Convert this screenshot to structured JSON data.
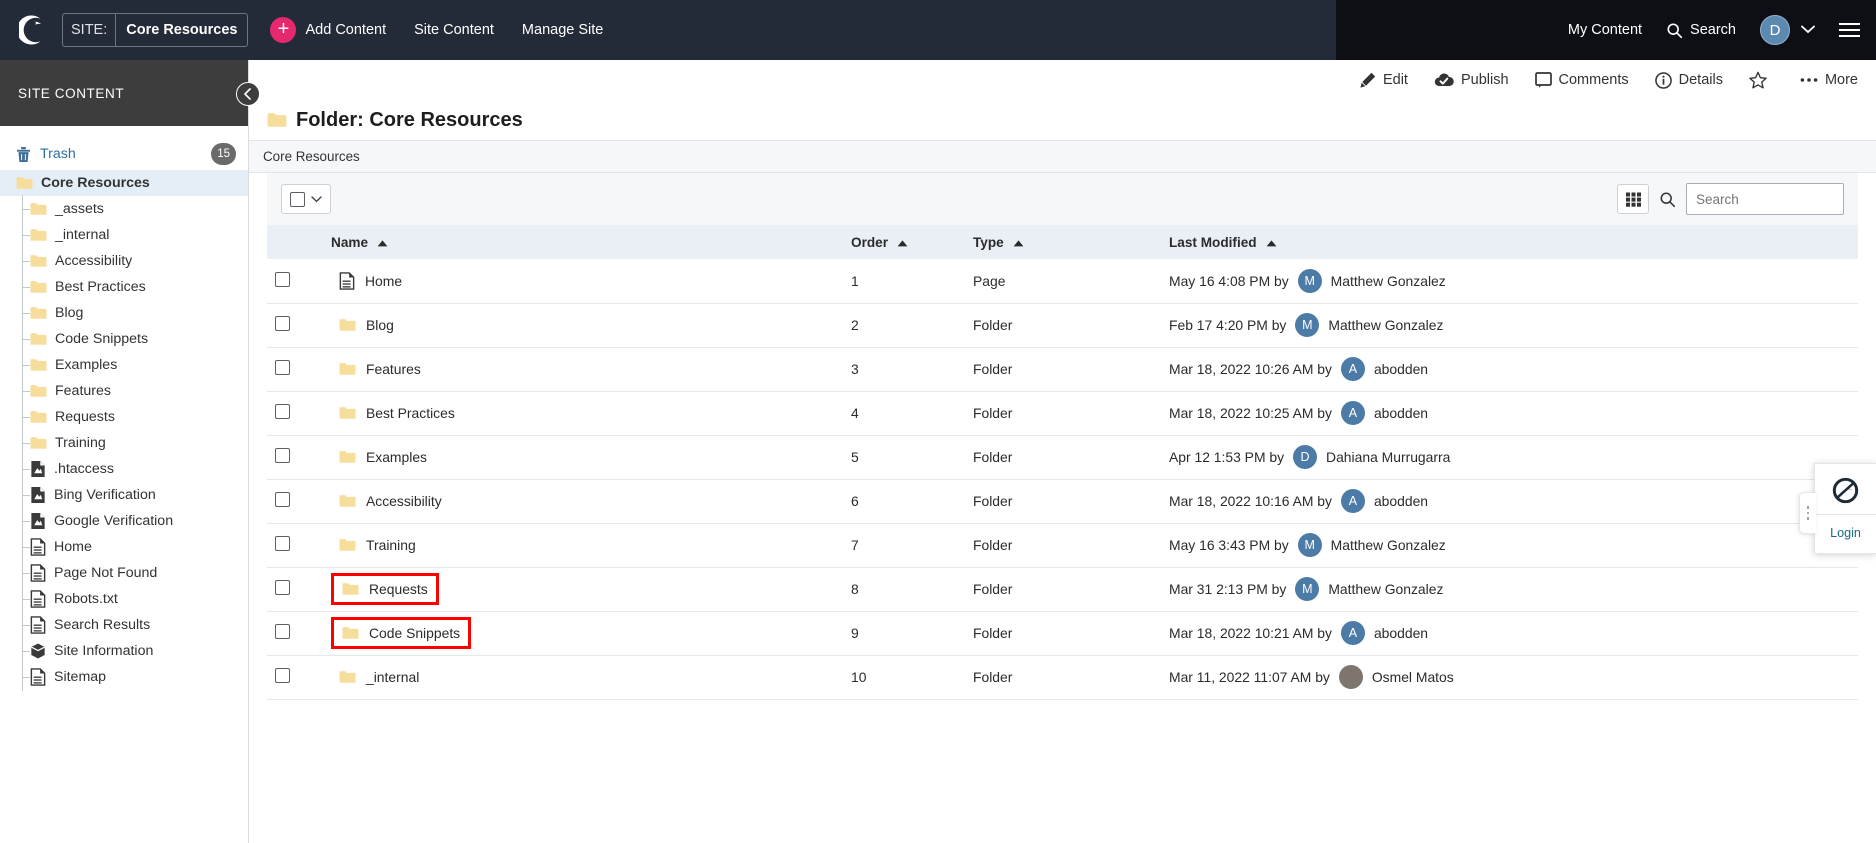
{
  "topbar": {
    "logo_icon": "cascade-moon-logo",
    "site_label": "SITE:",
    "site_value": "Core Resources",
    "add_content": "Add Content",
    "nav": [
      "Site Content",
      "Manage Site"
    ],
    "my_content": "My Content",
    "search": "Search",
    "avatar_initial": "D",
    "accent_color": "#e6286e",
    "bar_color": "#242b38"
  },
  "sidebar": {
    "header": "SITE CONTENT",
    "collapse_icon": "chevron-left-icon",
    "trash": {
      "label": "Trash",
      "count": "15",
      "icon": "trash-icon"
    },
    "tree": [
      {
        "label": "Core Resources",
        "icon": "folder-icon",
        "level": 0,
        "selected": true
      },
      {
        "label": "_assets",
        "icon": "folder-icon",
        "level": 1
      },
      {
        "label": "_internal",
        "icon": "folder-icon",
        "level": 1
      },
      {
        "label": "Accessibility",
        "icon": "folder-icon",
        "level": 1
      },
      {
        "label": "Best Practices",
        "icon": "folder-icon",
        "level": 1
      },
      {
        "label": "Blog",
        "icon": "folder-icon",
        "level": 1
      },
      {
        "label": "Code Snippets",
        "icon": "folder-icon",
        "level": 1
      },
      {
        "label": "Examples",
        "icon": "folder-icon",
        "level": 1
      },
      {
        "label": "Features",
        "icon": "folder-icon",
        "level": 1
      },
      {
        "label": "Requests",
        "icon": "folder-icon",
        "level": 1
      },
      {
        "label": "Training",
        "icon": "folder-icon",
        "level": 1
      },
      {
        "label": ".htaccess",
        "icon": "file-icon",
        "level": 1
      },
      {
        "label": "Bing Verification",
        "icon": "file-icon",
        "level": 1
      },
      {
        "label": "Google Verification",
        "icon": "file-icon",
        "level": 1
      },
      {
        "label": "Home",
        "icon": "page-icon",
        "level": 1
      },
      {
        "label": "Page Not Found",
        "icon": "page-icon",
        "level": 1
      },
      {
        "label": "Robots.txt",
        "icon": "page-icon",
        "level": 1
      },
      {
        "label": "Search Results",
        "icon": "page-icon",
        "level": 1
      },
      {
        "label": "Site Information",
        "icon": "block-icon",
        "level": 1
      },
      {
        "label": "Sitemap",
        "icon": "page-icon",
        "level": 1
      }
    ]
  },
  "actionbar": [
    {
      "label": "Edit",
      "icon": "pencil-icon"
    },
    {
      "label": "Publish",
      "icon": "cloud-check-icon"
    },
    {
      "label": "Comments",
      "icon": "comment-icon"
    },
    {
      "label": "Details",
      "icon": "info-circle-icon"
    },
    {
      "label": "",
      "icon": "star-icon"
    },
    {
      "label": "More",
      "icon": "ellipsis-icon"
    }
  ],
  "page": {
    "title": "Folder: Core Resources",
    "title_icon": "folder-icon",
    "breadcrumb": "Core Resources"
  },
  "table_toolbar": {
    "select_all_icon": "checkbox-icon",
    "select_dropdown_icon": "chevron-down-icon",
    "grid_view_icon": "grid-icon",
    "search_icon": "search-icon",
    "search_placeholder": "Search",
    "search_value": ""
  },
  "table": {
    "columns": [
      {
        "label": "Name",
        "sort": "asc"
      },
      {
        "label": "Order",
        "sort": "asc"
      },
      {
        "label": "Type",
        "sort": "asc"
      },
      {
        "label": "Last Modified",
        "sort": "asc"
      }
    ],
    "rows": [
      {
        "name": "Home",
        "icon": "page-icon",
        "order": "1",
        "type": "Page",
        "date": "May 16 4:08 PM by",
        "user": "Matthew Gonzalez",
        "initial": "M",
        "highlight": false
      },
      {
        "name": "Blog",
        "icon": "folder-icon",
        "order": "2",
        "type": "Folder",
        "date": "Feb 17 4:20 PM by",
        "user": "Matthew Gonzalez",
        "initial": "M",
        "highlight": false
      },
      {
        "name": "Features",
        "icon": "folder-icon",
        "order": "3",
        "type": "Folder",
        "date": "Mar 18, 2022 10:26 AM by",
        "user": "abodden",
        "initial": "A",
        "highlight": false
      },
      {
        "name": "Best Practices",
        "icon": "folder-icon",
        "order": "4",
        "type": "Folder",
        "date": "Mar 18, 2022 10:25 AM by",
        "user": "abodden",
        "initial": "A",
        "highlight": false
      },
      {
        "name": "Examples",
        "icon": "folder-icon",
        "order": "5",
        "type": "Folder",
        "date": "Apr 12 1:53 PM by",
        "user": "Dahiana Murrugarra",
        "initial": "D",
        "highlight": false
      },
      {
        "name": "Accessibility",
        "icon": "folder-icon",
        "order": "6",
        "type": "Folder",
        "date": "Mar 18, 2022 10:16 AM by",
        "user": "abodden",
        "initial": "A",
        "highlight": false
      },
      {
        "name": "Training",
        "icon": "folder-icon",
        "order": "7",
        "type": "Folder",
        "date": "May 16 3:43 PM by",
        "user": "Matthew Gonzalez",
        "initial": "M",
        "highlight": false
      },
      {
        "name": "Requests",
        "icon": "folder-icon",
        "order": "8",
        "type": "Folder",
        "date": "Mar 31 2:13 PM by",
        "user": "Matthew Gonzalez",
        "initial": "M",
        "highlight": true
      },
      {
        "name": "Code Snippets",
        "icon": "folder-icon",
        "order": "9",
        "type": "Folder",
        "date": "Mar 18, 2022 10:21 AM by",
        "user": "abodden",
        "initial": "A",
        "highlight": true
      },
      {
        "name": "_internal",
        "icon": "folder-icon",
        "order": "10",
        "type": "Folder",
        "date": "Mar 11, 2022 11:07 AM by",
        "user": "Osmel Matos",
        "initial": "",
        "highlight": false
      }
    ]
  },
  "float_widget": {
    "logo_icon": "circle-swoosh-logo",
    "login_label": "Login",
    "handle_icon": "drag-handle-icon"
  }
}
